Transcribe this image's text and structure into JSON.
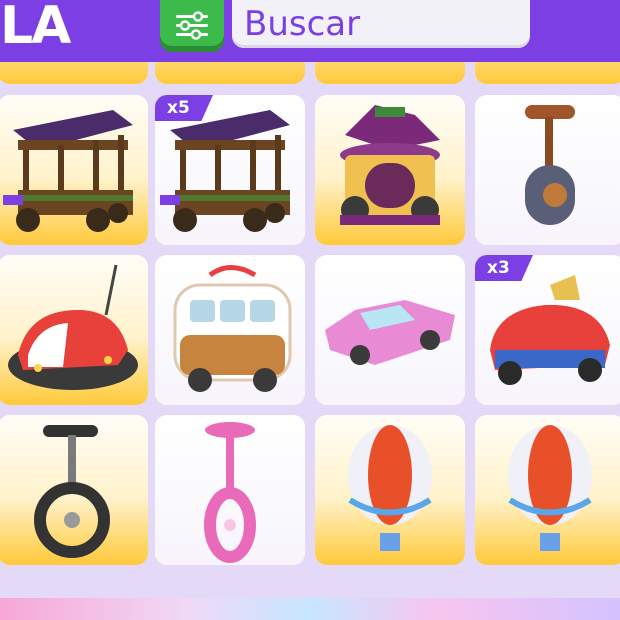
{
  "header": {
    "tab_label": "LA",
    "search_placeholder": "Buscar"
  },
  "colors": {
    "accent": "#7b3fe4",
    "filter_green": "#3dbb4a"
  },
  "grid": {
    "rows": [
      [
        {
          "name": "covered-wagon-cart",
          "badge": ""
        },
        {
          "name": "covered-wagon-cart",
          "badge": "x5"
        },
        {
          "name": "witch-hat-carriage",
          "badge": ""
        },
        {
          "name": "unicycle-seat",
          "badge": ""
        }
      ],
      [
        {
          "name": "bumper-car",
          "badge": ""
        },
        {
          "name": "gingerbread-van",
          "badge": ""
        },
        {
          "name": "pink-cadillac",
          "badge": ""
        },
        {
          "name": "clown-car",
          "badge": "x3"
        }
      ],
      [
        {
          "name": "black-unicycle",
          "badge": ""
        },
        {
          "name": "pink-unicycle",
          "badge": ""
        },
        {
          "name": "hot-air-balloon",
          "badge": ""
        },
        {
          "name": "hot-air-balloon",
          "badge": ""
        }
      ]
    ]
  }
}
